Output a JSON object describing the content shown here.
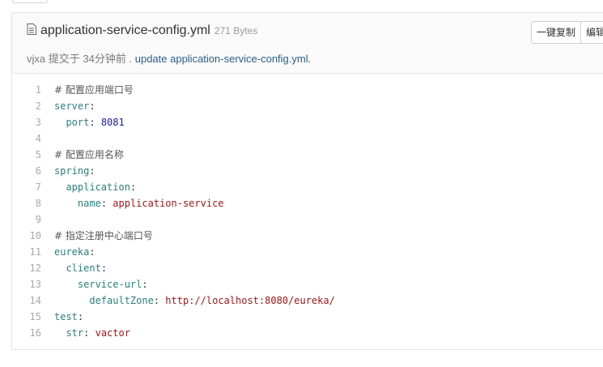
{
  "file": {
    "name": "application-service-config.yml",
    "size": "271 Bytes",
    "icon": "file-text-icon"
  },
  "commit": {
    "author": "vjxa",
    "action": "提交于",
    "time": "34分钟前",
    "separator": ".",
    "message": "update application-service-config.yml."
  },
  "buttons": {
    "copy_label": "一键复制",
    "edit_label": "编辑"
  },
  "code_lines": [
    {
      "num": "1",
      "parts": [
        {
          "t": "# 配置应用端口号",
          "c": "cmt"
        }
      ]
    },
    {
      "num": "2",
      "parts": [
        {
          "t": "server",
          "c": "key"
        },
        {
          "t": ":",
          "c": "txt"
        }
      ]
    },
    {
      "num": "3",
      "parts": [
        {
          "t": "  ",
          "c": "txt"
        },
        {
          "t": "port",
          "c": "key"
        },
        {
          "t": ": ",
          "c": "txt"
        },
        {
          "t": "8081",
          "c": "num"
        }
      ]
    },
    {
      "num": "4",
      "parts": []
    },
    {
      "num": "5",
      "parts": [
        {
          "t": "# 配置应用名称",
          "c": "cmt"
        }
      ]
    },
    {
      "num": "6",
      "parts": [
        {
          "t": "spring",
          "c": "key"
        },
        {
          "t": ":",
          "c": "txt"
        }
      ]
    },
    {
      "num": "7",
      "parts": [
        {
          "t": "  ",
          "c": "txt"
        },
        {
          "t": "application",
          "c": "key"
        },
        {
          "t": ":",
          "c": "txt"
        }
      ]
    },
    {
      "num": "8",
      "parts": [
        {
          "t": "    ",
          "c": "txt"
        },
        {
          "t": "name",
          "c": "key"
        },
        {
          "t": ": ",
          "c": "txt"
        },
        {
          "t": "application-service",
          "c": "str"
        }
      ]
    },
    {
      "num": "9",
      "parts": []
    },
    {
      "num": "10",
      "parts": [
        {
          "t": "# 指定注册中心端口号",
          "c": "cmt"
        }
      ]
    },
    {
      "num": "11",
      "parts": [
        {
          "t": "eureka",
          "c": "key"
        },
        {
          "t": ":",
          "c": "txt"
        }
      ]
    },
    {
      "num": "12",
      "parts": [
        {
          "t": "  ",
          "c": "txt"
        },
        {
          "t": "client",
          "c": "key"
        },
        {
          "t": ":",
          "c": "txt"
        }
      ]
    },
    {
      "num": "13",
      "parts": [
        {
          "t": "    ",
          "c": "txt"
        },
        {
          "t": "service-url",
          "c": "key"
        },
        {
          "t": ":",
          "c": "txt"
        }
      ]
    },
    {
      "num": "14",
      "parts": [
        {
          "t": "      ",
          "c": "txt"
        },
        {
          "t": "defaultZone",
          "c": "key"
        },
        {
          "t": ": ",
          "c": "txt"
        },
        {
          "t": "http://localhost:8080/eureka/",
          "c": "str"
        }
      ]
    },
    {
      "num": "15",
      "parts": [
        {
          "t": "test",
          "c": "key"
        },
        {
          "t": ":",
          "c": "txt"
        }
      ]
    },
    {
      "num": "16",
      "parts": [
        {
          "t": "  ",
          "c": "txt"
        },
        {
          "t": "str",
          "c": "key"
        },
        {
          "t": ": ",
          "c": "txt"
        },
        {
          "t": "vactor",
          "c": "str"
        }
      ]
    }
  ]
}
